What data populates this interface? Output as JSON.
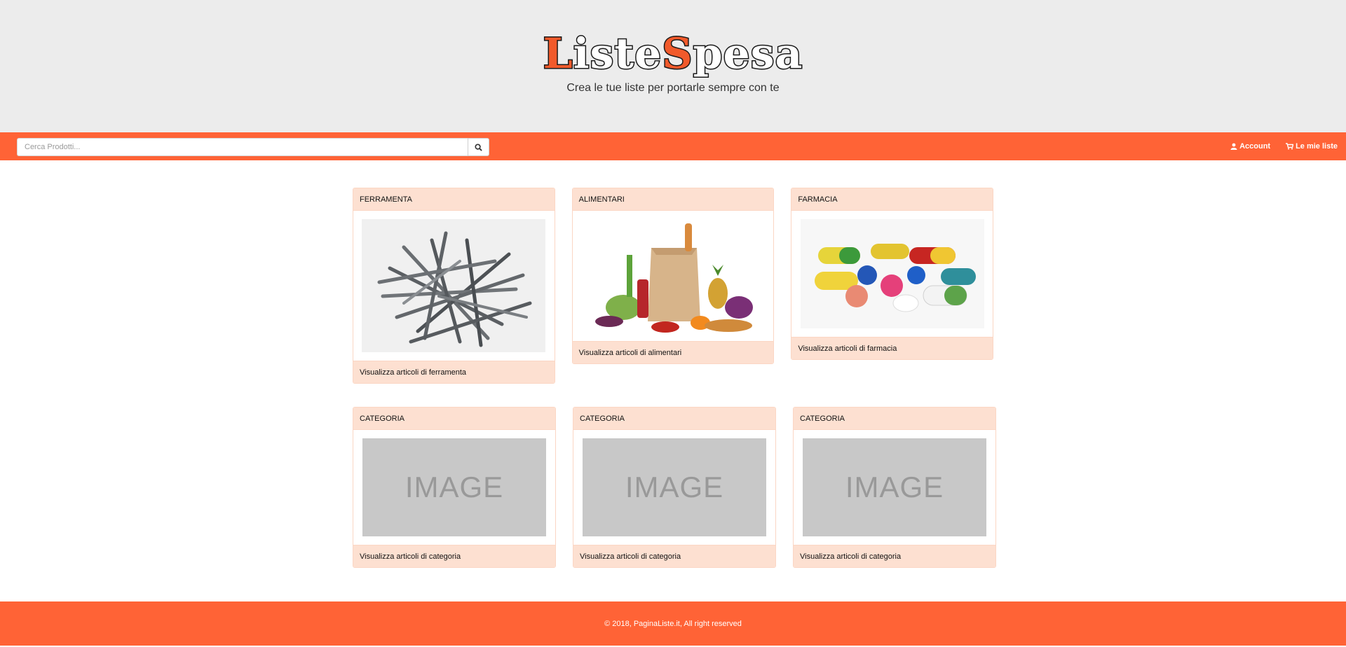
{
  "header": {
    "logo": {
      "part1": "Liste",
      "part2": "Spesa"
    },
    "tagline": "Crea le tue liste per portarle sempre con te"
  },
  "navbar": {
    "search_placeholder": "Cerca Prodotti...",
    "search_icon": "search-icon",
    "links": [
      {
        "label": "Account",
        "icon": "user-icon"
      },
      {
        "label": "Le mie liste",
        "icon": "cart-icon"
      }
    ],
    "color": "#ff6336"
  },
  "categories": [
    {
      "title": "FERRAMENTA",
      "footer": "Visualizza articoli di ferramenta",
      "image": "nails"
    },
    {
      "title": "ALIMENTARI",
      "footer": "Visualizza articoli di alimentari",
      "image": "groceries"
    },
    {
      "title": "FARMACIA",
      "footer": "Visualizza articoli di farmacia",
      "image": "pills"
    },
    {
      "title": "CATEGORIA",
      "footer": "Visualizza articoli di categoria",
      "image": "IMAGE"
    },
    {
      "title": "CATEGORIA",
      "footer": "Visualizza articoli di categoria",
      "image": "IMAGE"
    },
    {
      "title": "CATEGORIA",
      "footer": "Visualizza articoli di categoria",
      "image": "IMAGE"
    }
  ],
  "footer": {
    "text": "© 2018, PaginaListe.it, All right reserved"
  }
}
